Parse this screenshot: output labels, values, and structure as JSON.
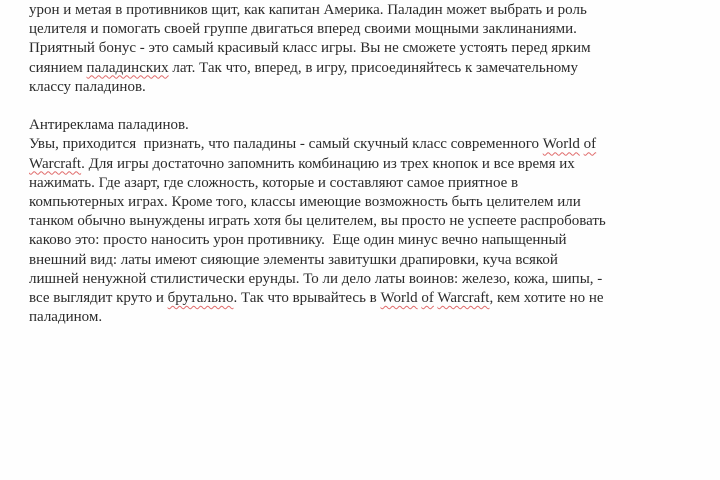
{
  "document": {
    "background_color": "#fefefe",
    "text_color": "#2b2b2b",
    "spellcheck_underline_color": "#e06b6b",
    "lines": [
      {
        "segments": [
          {
            "text": "урон и метая в противников щит, как капитан Америка. Паладин может выбрать и роль",
            "misspelled": false
          }
        ]
      },
      {
        "segments": [
          {
            "text": "целителя и помогать своей группе двигаться вперед своими мощными заклинаниями.",
            "misspelled": false
          }
        ]
      },
      {
        "segments": [
          {
            "text": "Приятный бонус - это самый красивый класс игры. Вы не сможете устоять перед ярким",
            "misspelled": false
          }
        ]
      },
      {
        "segments": [
          {
            "text": "сиянием ",
            "misspelled": false
          },
          {
            "text": "паладинских",
            "misspelled": true
          },
          {
            "text": " лат. Так что, вперед, в игру, присоединяйтесь к замечательному",
            "misspelled": false
          }
        ]
      },
      {
        "segments": [
          {
            "text": "классу паладинов.",
            "misspelled": false
          }
        ]
      },
      {
        "segments": []
      },
      {
        "segments": [
          {
            "text": "Антиреклама паладинов.",
            "misspelled": false
          }
        ]
      },
      {
        "segments": [
          {
            "text": "Увы, приходится  признать, что паладины - самый скучный класс современного ",
            "misspelled": false
          },
          {
            "text": "World",
            "misspelled": true
          },
          {
            "text": " ",
            "misspelled": false
          },
          {
            "text": "of",
            "misspelled": true
          }
        ]
      },
      {
        "segments": [
          {
            "text": "Warcraft",
            "misspelled": true
          },
          {
            "text": ". Для игры достаточно запомнить комбинацию из трех кнопок и все время их",
            "misspelled": false
          }
        ]
      },
      {
        "segments": [
          {
            "text": "нажимать. Где азарт, где сложность, которые и составляют самое приятное в",
            "misspelled": false
          }
        ]
      },
      {
        "segments": [
          {
            "text": "компьютерных играх. Кроме того, классы имеющие возможность быть целителем или",
            "misspelled": false
          }
        ]
      },
      {
        "segments": [
          {
            "text": "танком обычно вынуждены играть хотя бы целителем, вы просто не успеете распробовать",
            "misspelled": false
          }
        ]
      },
      {
        "segments": [
          {
            "text": "каково это: просто наносить урон противнику.  Еще один минус вечно напыщенный",
            "misspelled": false
          }
        ]
      },
      {
        "segments": [
          {
            "text": "внешний вид: латы имеют сияющие элементы завитушки драпировки, куча всякой",
            "misspelled": false
          }
        ]
      },
      {
        "segments": [
          {
            "text": "лишней ненужной стилистически ерунды. То ли дело латы воинов: железо, кожа, шипы, -",
            "misspelled": false
          }
        ]
      },
      {
        "segments": [
          {
            "text": "все выглядит круто и ",
            "misspelled": false
          },
          {
            "text": "брутально",
            "misspelled": true
          },
          {
            "text": ". Так что врывайтесь в ",
            "misspelled": false
          },
          {
            "text": "World",
            "misspelled": true
          },
          {
            "text": " ",
            "misspelled": false
          },
          {
            "text": "of",
            "misspelled": true
          },
          {
            "text": " ",
            "misspelled": false
          },
          {
            "text": "Warcraft",
            "misspelled": true
          },
          {
            "text": ", кем хотите но не",
            "misspelled": false
          }
        ]
      },
      {
        "segments": [
          {
            "text": "паладином.",
            "misspelled": false
          }
        ]
      }
    ]
  }
}
